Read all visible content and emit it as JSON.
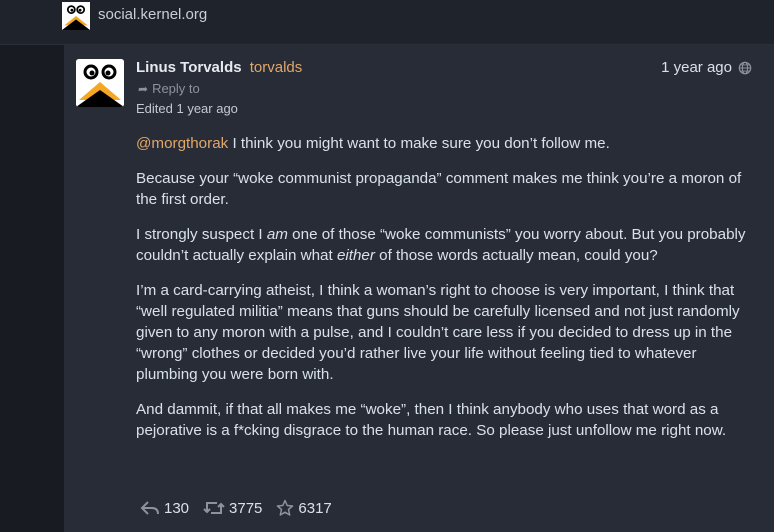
{
  "site": {
    "domain": "social.kernel.org"
  },
  "status": {
    "display_name": "Linus Torvalds",
    "username": "torvalds",
    "reply_to": "Reply to",
    "edited": "Edited 1 year ago",
    "time": "1 year ago",
    "mention": "@morgthorak",
    "p1_rest": " I think you might want to make sure you don’t follow me.",
    "p2": "Because your “woke communist propaganda” comment makes me think you’re a moron of the first order.",
    "p3_a": "I strongly suspect I ",
    "p3_em1": "am",
    "p3_b": " one of those “woke communists” you worry about. But you probably couldn’t actually explain what ",
    "p3_em2": "either",
    "p3_c": " of those words actually mean, could you?",
    "p4": "I’m a card-carrying atheist, I think a woman’s right to choose is very important, I think that “well regulated militia” means that guns should be carefully licensed and not just randomly given to any moron with a pulse, and I couldn’t care less if you decided to dress up in the “wrong” clothes or decided you’d rather live your life without feeling tied to whatever plumbing you were born with.",
    "p5": "And dammit, if that all makes me “woke”, then I think anybody who uses that word as a pejorative is a f*cking disgrace to the human race. So please just unfollow me right now."
  },
  "actions": {
    "replies": "130",
    "boosts": "3775",
    "favourites": "6317"
  },
  "icons": {
    "site_avatar": "tux-penguin-icon",
    "avatar": "tux-penguin-icon",
    "reply": "reply-icon",
    "boost": "retweet-icon",
    "favourite": "star-icon",
    "visibility": "globe-icon"
  }
}
